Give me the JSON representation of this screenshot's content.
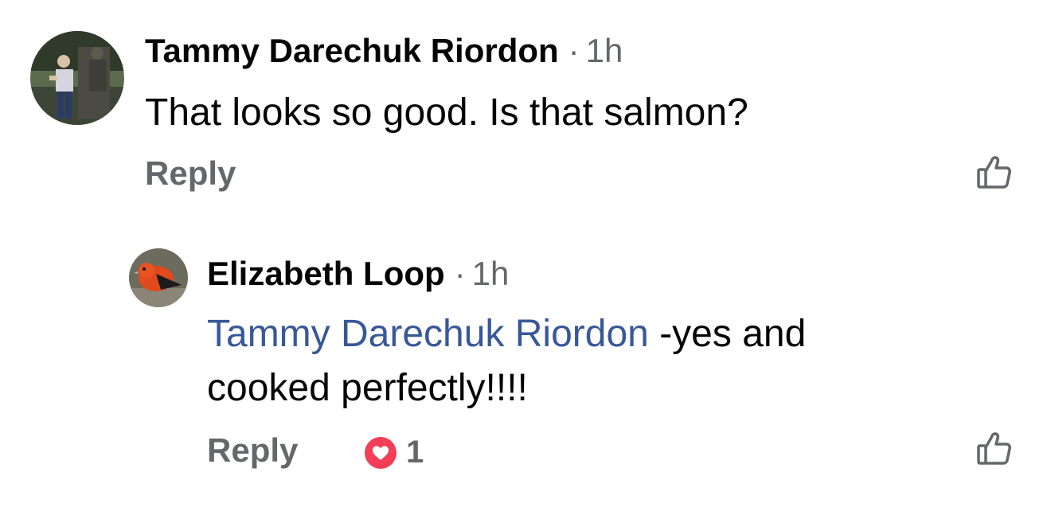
{
  "comments": [
    {
      "author": "Tammy Darechuk Riordon",
      "separator": "·",
      "time": "1h",
      "text": "That looks so good. Is that salmon?",
      "reply_label": "Reply",
      "like_icon": "thumbs-up-outline-icon",
      "avatar_icon": "person-with-statue-photo"
    },
    {
      "author": "Elizabeth Loop",
      "separator": "·",
      "time": "1h",
      "mention": "Tammy Darechuk Riordon",
      "text_line1": " -yes and",
      "text_line2": "cooked perfectly!!!!",
      "reply_label": "Reply",
      "reaction_icon": "heart-reaction-icon",
      "reaction_count": "1",
      "like_icon": "thumbs-up-outline-icon",
      "avatar_icon": "red-bird-photo"
    }
  ],
  "colors": {
    "mention": "#385898",
    "secondary_text": "#65676b",
    "heart": "#f33e58"
  }
}
